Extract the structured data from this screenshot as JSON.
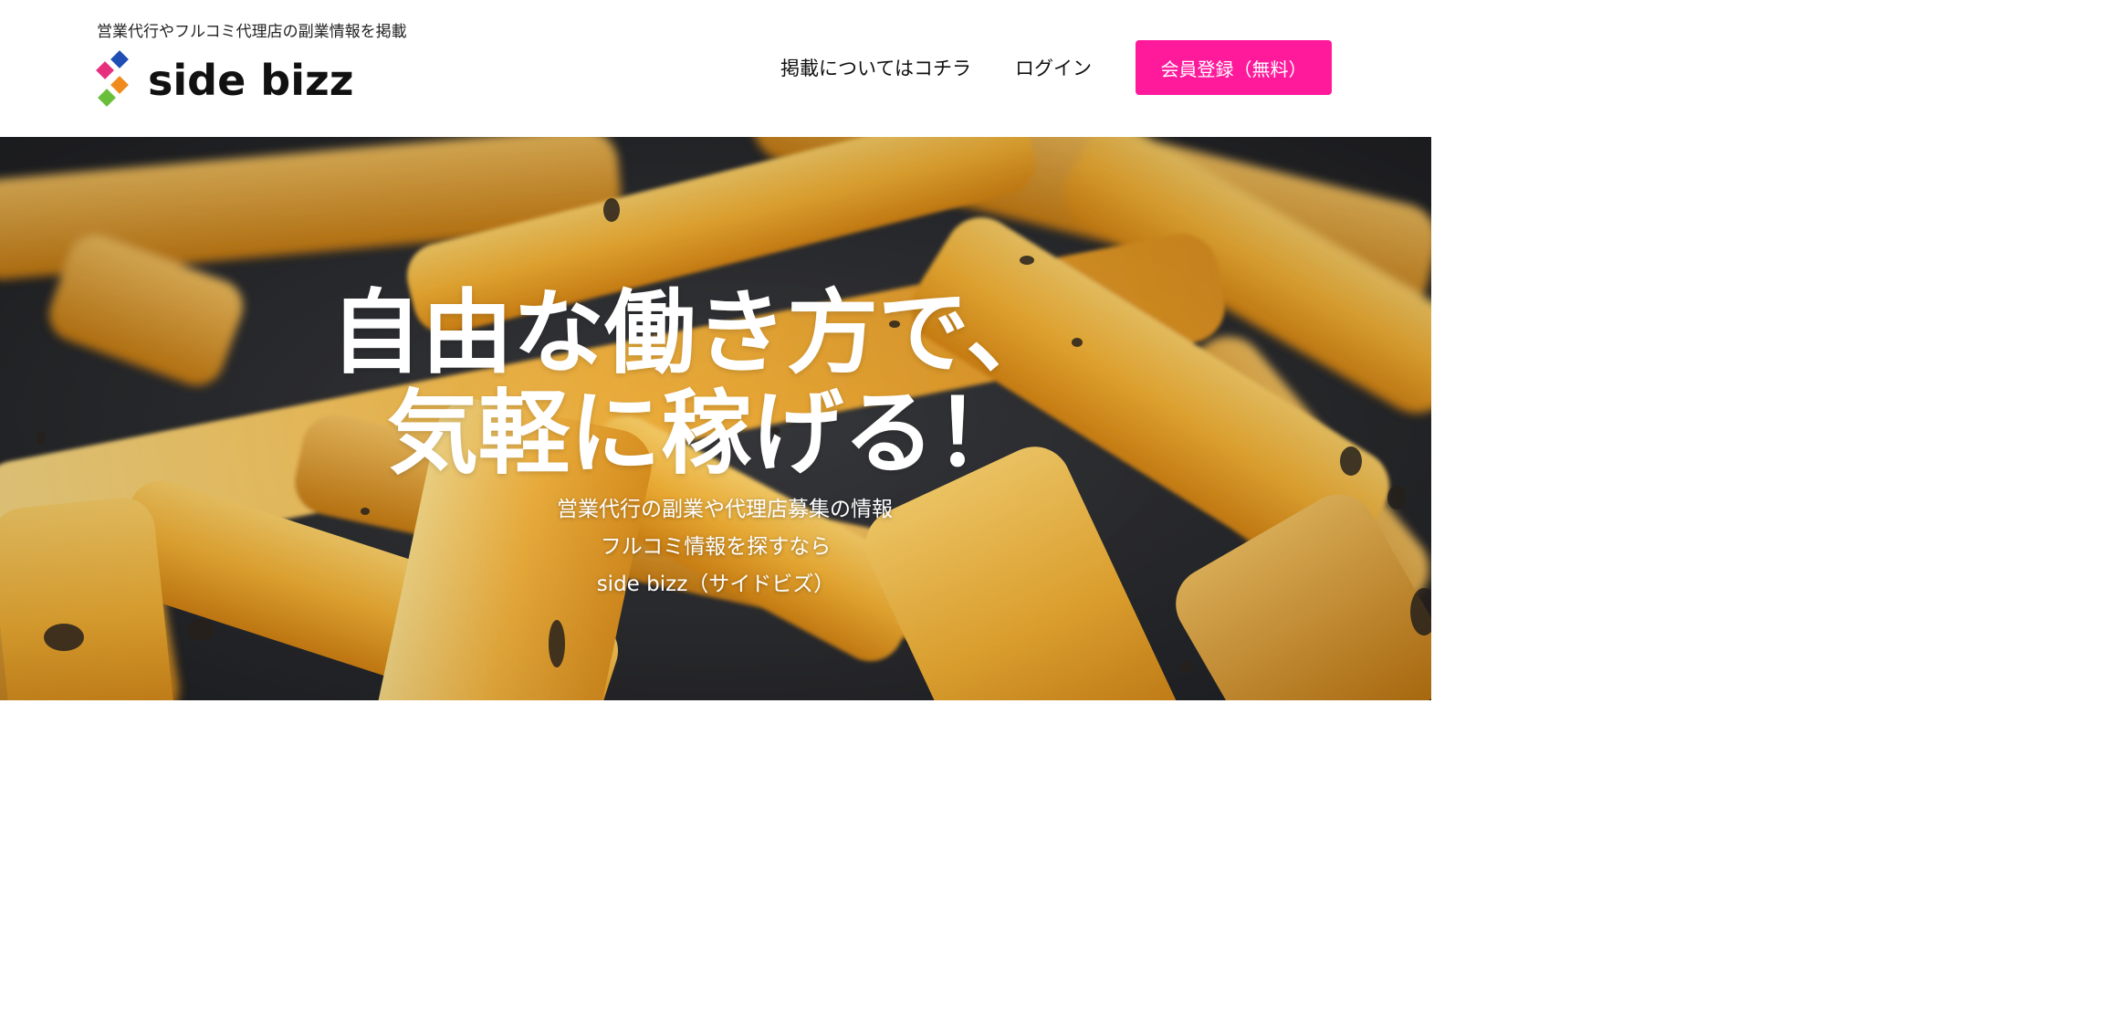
{
  "header": {
    "tagline": "営業代行やフルコミ代理店の副業情報を掲載",
    "logo_text": "side bizz",
    "logo_colors": {
      "blue": "#1f4fb5",
      "pink": "#e6307e",
      "orange": "#f08a1c",
      "green": "#6abf3a"
    }
  },
  "nav": {
    "listing_label": "掲載についてはコチラ",
    "login_label": "ログイン",
    "register_label": "会員登録（無料）",
    "register_color": "#ff1a9c"
  },
  "hero": {
    "headline_line1": "自由な働き方で、",
    "headline_line2": "気軽に稼げる！",
    "sub_line1": "営業代行の副業や代理店募集の情報",
    "sub_line2": "フルコミ情報を探すなら",
    "sub_line3": "side bizz（サイドビズ）",
    "image": "sweet-potato-fries-photo"
  }
}
